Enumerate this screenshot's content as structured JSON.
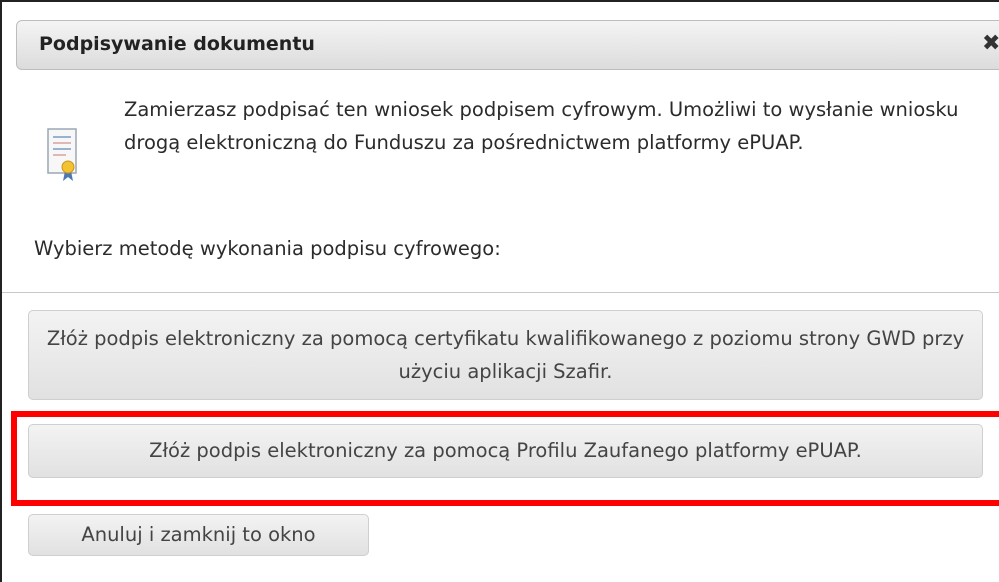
{
  "dialog": {
    "title": "Podpisywanie dokumentu",
    "close_symbol": "✖",
    "icon": "signed-document-icon",
    "intro_text": "Zamierzasz podpisać ten wniosek podpisem cyfrowym. Umożliwi to wysłanie wniosku drogą elektroniczną do Funduszu za pośrednictwem platformy ePUAP.",
    "choose_label": "Wybierz metodę wykonania podpisu cyfrowego:",
    "option_szafir_label": "Złóż podpis elektroniczny za pomocą certyfikatu kwalifikowanego z poziomu strony GWD przy użyciu aplikacji Szafir.",
    "option_epuap_label": "Złóż podpis elektroniczny za pomocą Profilu Zaufanego platformy ePUAP.",
    "cancel_label": "Anuluj i zamknij to okno"
  },
  "colors": {
    "highlight": "#ff0000",
    "button_bg": "#e6e6e6",
    "titlebar_bg": "#e4e4e4"
  }
}
